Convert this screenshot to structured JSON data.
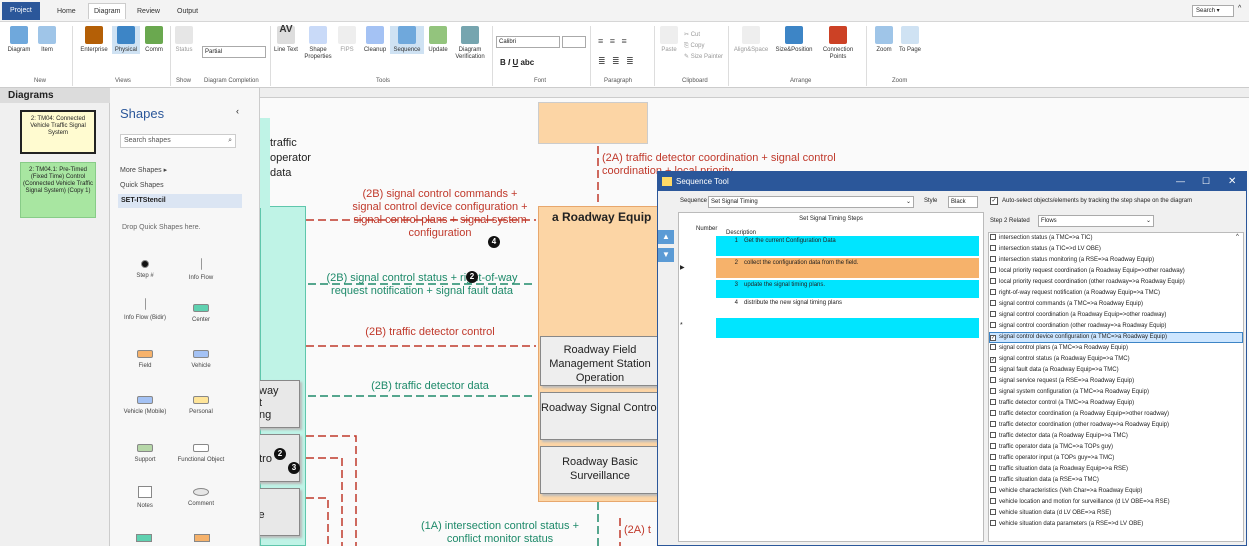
{
  "tabs": [
    "Project",
    "Home",
    "Diagram",
    "Review",
    "Output"
  ],
  "search": {
    "label": "Search"
  },
  "ribbon": {
    "buttons": [
      {
        "label": "Diagram"
      },
      {
        "label": "Item"
      },
      {
        "label": "Enterprise"
      },
      {
        "label": "Physical"
      },
      {
        "label": "Comm"
      },
      {
        "label": "Status"
      },
      {
        "label": "Line Text"
      },
      {
        "label": "Shape Properties"
      },
      {
        "label": "FIPS"
      },
      {
        "label": "Cleanup"
      },
      {
        "label": "Sequence"
      },
      {
        "label": "Update"
      },
      {
        "label": "Diagram Verification"
      },
      {
        "label": "Paste"
      },
      {
        "label": "Cut"
      },
      {
        "label": "Copy"
      },
      {
        "label": "Size Painter"
      },
      {
        "label": "Align&Space"
      },
      {
        "label": "Size&Position"
      },
      {
        "label": "Connection Points"
      },
      {
        "label": "Zoom"
      },
      {
        "label": "To Page"
      }
    ],
    "partial": "Partial",
    "font_name": "Calibri",
    "groups": [
      "New",
      "Views",
      "Show",
      "Diagram Completion",
      "Tools",
      "Font",
      "Paragraph",
      "Clipboard",
      "Arrange",
      "Zoom"
    ]
  },
  "diagrams": {
    "title": "Diagrams",
    "items": [
      {
        "label": "2: TM04: Connected Vehicle Traffic Signal System"
      },
      {
        "label": "2: TM04.1: Pre-Timed (Fixed Time) Control (Connected Vehicle Traffic Signal System) (Copy 1)"
      }
    ]
  },
  "shapes": {
    "title": "Shapes",
    "search_placeholder": "Search shapes",
    "more": "More Shapes",
    "quick": "Quick Shapes",
    "stencil": "SET-ITStencil",
    "drop_hint": "Drop Quick Shapes here.",
    "items": [
      "Step #",
      "Info Flow",
      "Info Flow (Bidir)",
      "Center",
      "Field",
      "Vehicle",
      "Vehicle (Mobile)",
      "Personal",
      "Support",
      "Functional Object",
      "Notes",
      "Comment"
    ]
  },
  "canvas": {
    "traffic_operator": "traffic operator data",
    "roadway_equip": "a Roadway Equip",
    "boxes": [
      "Roadway Field Management Station Operation",
      "Roadway Signal Control",
      "Roadway Basic Surveillance"
    ],
    "flows": [
      "(2A) traffic detector coordination + signal control coordination + local priority",
      "(2B) signal control commands + signal control device configuration + signal control plans + signal system configuration",
      "(2B) signal control status + right-of-way request notification + signal fault data",
      "(2B) traffic detector control",
      "(2B) traffic detector data",
      "(1A) intersection control status + conflict monitor status",
      "(2A) t"
    ],
    "left_box_texts": [
      "way",
      "t",
      "ng",
      "ntro",
      "c",
      "ce"
    ],
    "steps": [
      "4",
      "2",
      "2",
      "3"
    ]
  },
  "sequence_tool": {
    "title": "Sequence Tool",
    "sequence_label": "Sequence",
    "sequence_value": "Set Signal Timing",
    "style_label": "Style",
    "style_value": "Black",
    "auto_select": "Auto-select objects/elements by tracking the step shape on the diagram",
    "table_title": "Set Signal Timing Steps",
    "col_number": "Number",
    "col_desc": "Description",
    "steps": [
      {
        "n": "1",
        "d": "Get the current Configuration Data"
      },
      {
        "n": "2",
        "d": "collect the configuration data from the field."
      },
      {
        "n": "3",
        "d": "update the signal timing plans."
      },
      {
        "n": "4",
        "d": "distribute the new signal timing plans"
      }
    ],
    "related_label": "Step 2 Related",
    "related_value": "Flows",
    "flows": [
      "intersection status (a TMC=>a TIC)",
      "intersection status (a TIC=>d LV OBE)",
      "intersection status monitoring (a RSE=>a Roadway Equip)",
      "local priority request coordination (a Roadway Equip=>other roadway)",
      "local priority request coordination (other roadway=>a Roadway Equip)",
      "right-of-way request notification (a Roadway Equip=>a TMC)",
      "signal control commands (a TMC=>a Roadway Equip)",
      "signal control coordination (a Roadway Equip=>other roadway)",
      "signal control coordination (other roadway=>a Roadway Equip)",
      "signal control device configuration (a TMC=>a Roadway Equip)",
      "signal control plans (a TMC=>a Roadway Equip)",
      "signal control status (a Roadway Equip=>a TMC)",
      "signal fault data (a Roadway Equip=>a TMC)",
      "signal service request (a RSE=>a Roadway Equip)",
      "signal system configuration (a TMC=>a Roadway Equip)",
      "traffic detector control (a TMC=>a Roadway Equip)",
      "traffic detector coordination (a Roadway Equip=>other roadway)",
      "traffic detector coordination (other roadway=>a Roadway Equip)",
      "traffic detector data (a Roadway Equip=>a TMC)",
      "traffic operator data (a TMC=>a TOPs guy)",
      "traffic operator input (a TOPs guy=>a TMC)",
      "traffic situation data (a Roadway Equip=>a RSE)",
      "traffic situation data (a RSE=>a TMC)",
      "vehicle characteristics (Veh Char=>a Roadway Equip)",
      "vehicle location and motion for surveillance (d LV OBE=>a RSE)",
      "vehicle situation data (d LV OBE=>a RSE)",
      "vehicle situation data parameters (a RSE=>d LV OBE)"
    ],
    "checked": [
      9,
      11
    ],
    "selected": 9
  }
}
